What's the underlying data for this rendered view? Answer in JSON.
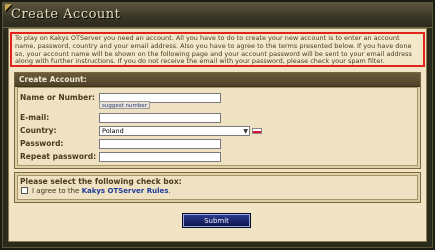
{
  "header": {
    "title": "Create Account"
  },
  "notice": {
    "text": "To play on Kakys OTServer you need an account. All you have to do to create your new account is to enter an account name, password, country and your email address. Also you have to agree to the terms presented below. If you have done so, your account name will be shown on the following page and your account password will be sent to your email address along with further instructions. If you do not receive the email with your password, please check your spam filter."
  },
  "form": {
    "heading": "Create Account:",
    "account_label": "Name or Number:",
    "account_value": "",
    "suggest_label": "suggest number",
    "email_label": "E-mail:",
    "email_value": "",
    "country_label": "Country:",
    "country_value": "Poland",
    "password_label": "Password:",
    "password_value": "",
    "repeat_label": "Repeat password:",
    "repeat_value": ""
  },
  "terms": {
    "heading": "Please select the following check box:",
    "agree_prefix": "I agree to the",
    "rules_link": "Kakys OTServer Rules",
    "agree_suffix": "."
  },
  "submit_label": "Submit",
  "colors": {
    "notice_border": "#e2241c",
    "submit_bg": "#13206b",
    "link": "#1f3c9a"
  }
}
